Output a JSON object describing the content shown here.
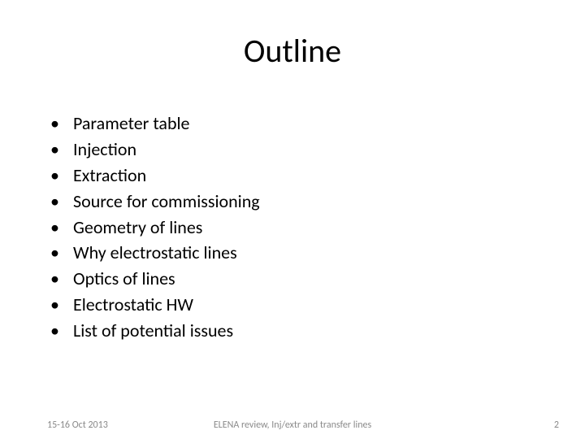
{
  "title": "Outline",
  "bullets": [
    "Parameter table",
    "Injection",
    "Extraction",
    "Source for commissioning",
    "Geometry of lines",
    "Why electrostatic lines",
    "Optics of lines",
    "Electrostatic HW",
    "List of potential issues"
  ],
  "footer": {
    "date": "15-16 Oct 2013",
    "center": "ELENA review, Inj/extr and transfer lines",
    "page": "2"
  }
}
